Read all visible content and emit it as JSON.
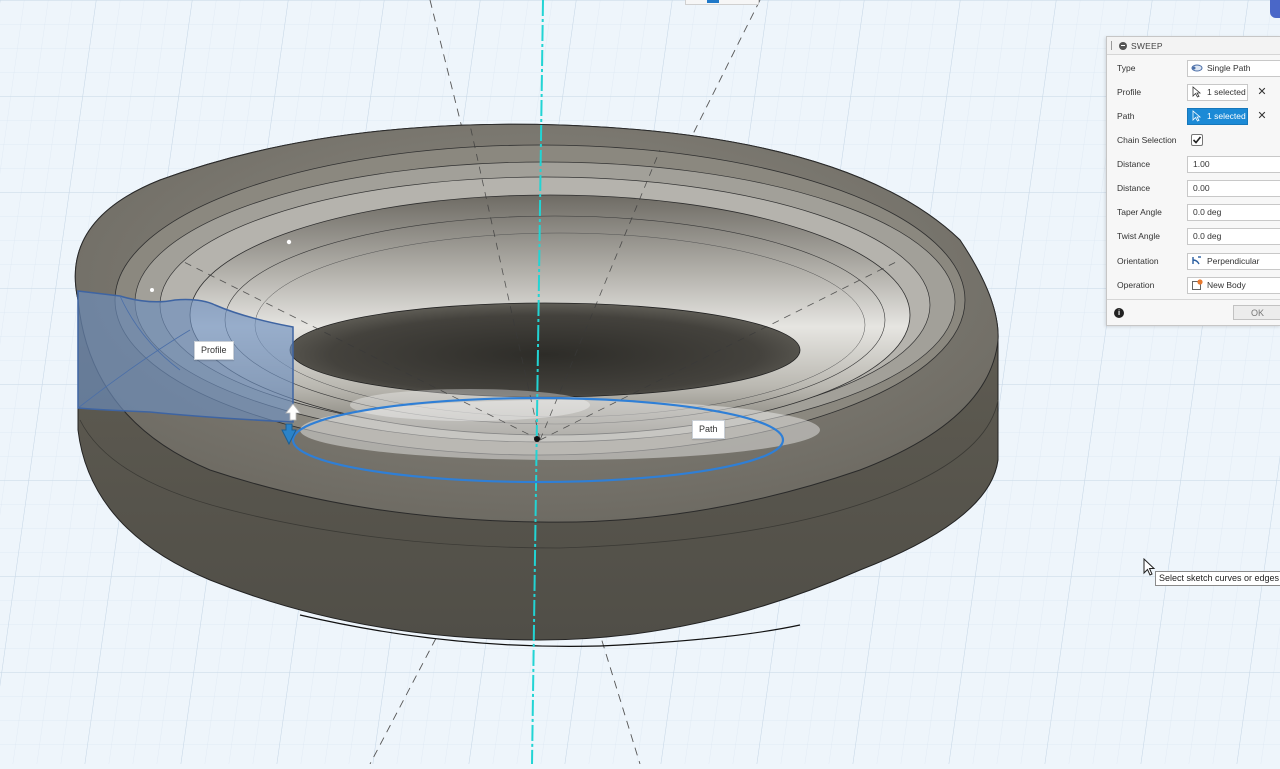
{
  "viewport": {
    "labels": {
      "profile": "Profile",
      "path": "Path"
    },
    "tooltip": "Select sketch curves or edges",
    "colors": {
      "background": "#eef5fb",
      "grid": "#d3e1ee",
      "body_dark": "#5f5c54",
      "body_light": "#d9d7d1",
      "selection": "#6d8fbf",
      "path_highlight": "#2f7fd6",
      "axis": "#22d4d4"
    }
  },
  "sweep_dialog": {
    "title": "SWEEP",
    "fields": {
      "type": {
        "label": "Type",
        "value": "Single Path",
        "icon": "single-path-icon"
      },
      "profile": {
        "label": "Profile",
        "value": "1 selected",
        "icon": "select-arrow-icon"
      },
      "path": {
        "label": "Path",
        "value": "1 selected",
        "icon": "select-arrow-icon",
        "active": true
      },
      "chain_selection": {
        "label": "Chain Selection",
        "checked": true
      },
      "distance1": {
        "label": "Distance",
        "value": "1.00"
      },
      "distance2": {
        "label": "Distance",
        "value": "0.00"
      },
      "taper_angle": {
        "label": "Taper Angle",
        "value": "0.0 deg"
      },
      "twist_angle": {
        "label": "Twist Angle",
        "value": "0.0 deg"
      },
      "orientation": {
        "label": "Orientation",
        "value": "Perpendicular",
        "icon": "orientation-icon"
      },
      "operation": {
        "label": "Operation",
        "value": "New Body",
        "icon": "new-body-icon"
      }
    },
    "ok_label": "OK",
    "accent": "#1c8ad6"
  }
}
